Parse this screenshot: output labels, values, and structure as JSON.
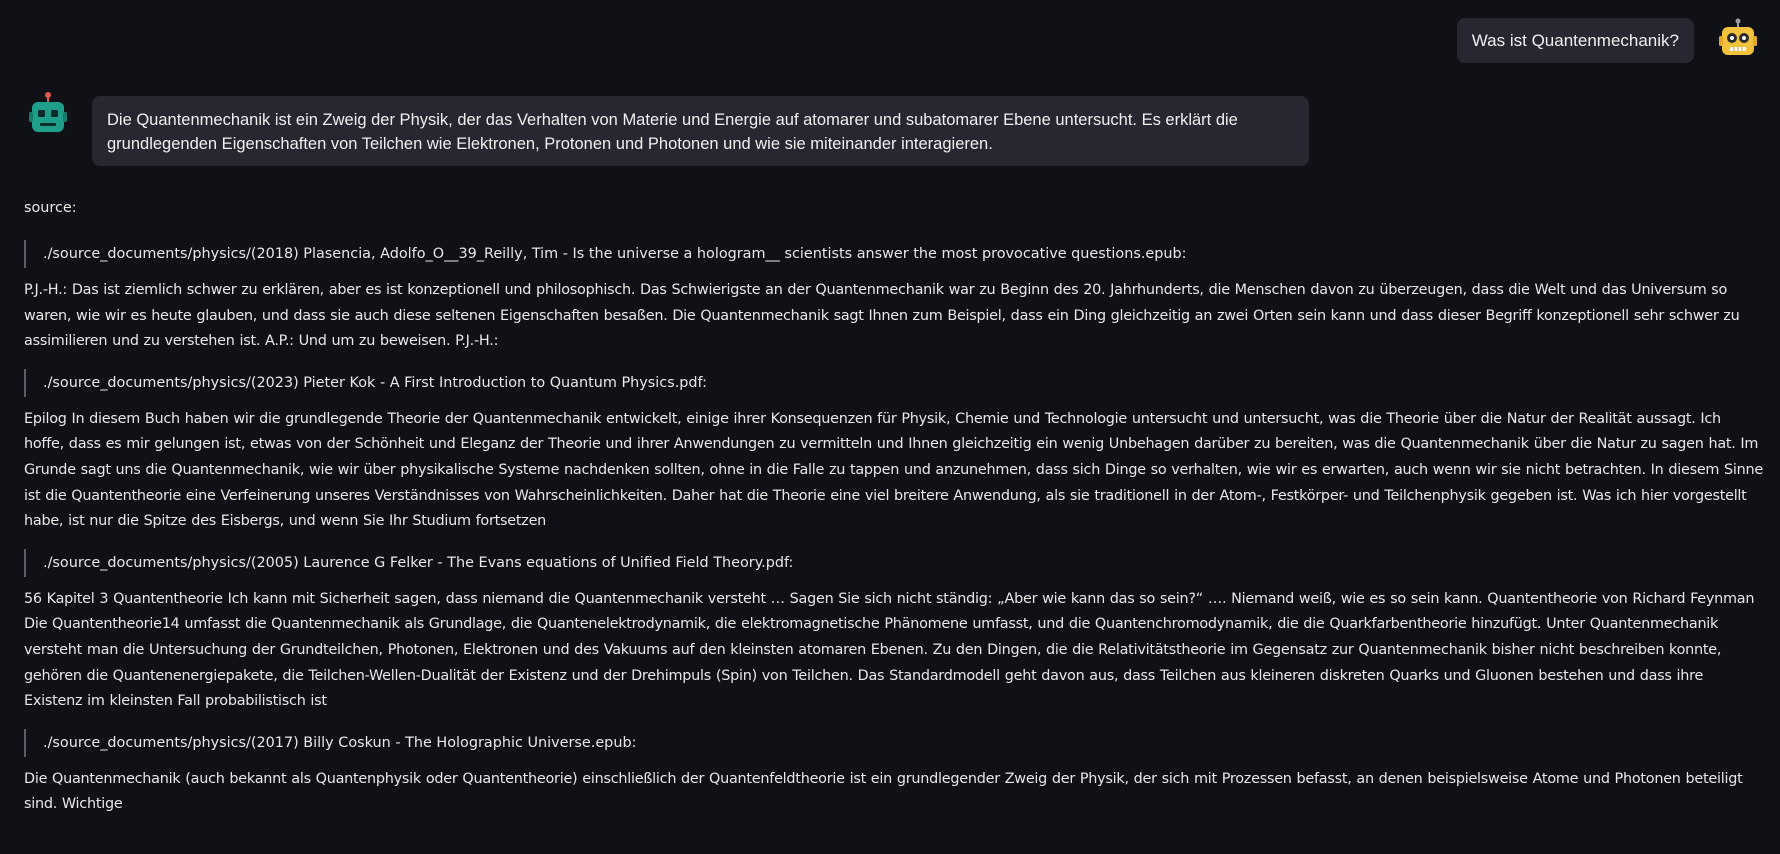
{
  "user_message": {
    "text": "Was ist Quantenmechanik?",
    "avatar_icon": "robot-yellow-icon"
  },
  "assistant_message": {
    "text": "Die Quantenmechanik ist ein Zweig der Physik, der das Verhalten von Materie und Energie auf atomarer und subatomarer Ebene untersucht. Es erklärt die grundlegenden Eigenschaften von Teilchen wie Elektronen, Protonen und Photonen und wie sie miteinander interagieren.",
    "avatar_icon": "robot-teal-icon"
  },
  "sources": {
    "label": "source:",
    "items": [
      {
        "path": "./source_documents/physics/(2018) Plasencia, Adolfo_O__39_Reilly, Tim - Is the universe a hologram__ scientists answer the most provocative questions.epub:",
        "excerpt": "P.J.-H.: Das ist ziemlich schwer zu erklären, aber es ist konzeptionell und philosophisch. Das Schwierigste an der Quantenmechanik war zu Beginn des 20. Jahrhunderts, die Menschen davon zu überzeugen, dass die Welt und das Universum so waren, wie wir es heute glauben, und dass sie auch diese seltenen Eigenschaften besaßen. Die Quantenmechanik sagt Ihnen zum Beispiel, dass ein Ding gleichzeitig an zwei Orten sein kann und dass dieser Begriff konzeptionell sehr schwer zu assimilieren und zu verstehen ist. A.P.: Und um zu beweisen. P.J.-H.:"
      },
      {
        "path": "./source_documents/physics/(2023) Pieter Kok - A First Introduction to Quantum Physics.pdf:",
        "excerpt": "Epilog In diesem Buch haben wir die grundlegende Theorie der Quantenmechanik entwickelt, einige ihrer Konsequenzen für Physik, Chemie und Technologie untersucht und untersucht, was die Theorie über die Natur der Realität aussagt. Ich hoffe, dass es mir gelungen ist, etwas von der Schönheit und Eleganz der Theorie und ihrer Anwendungen zu vermitteln und Ihnen gleichzeitig ein wenig Unbehagen darüber zu bereiten, was die Quantenmechanik über die Natur zu sagen hat. Im Grunde sagt uns die Quantenmechanik, wie wir über physikalische Systeme nachdenken sollten, ohne in die Falle zu tappen und anzunehmen, dass sich Dinge so verhalten, wie wir es erwarten, auch wenn wir sie nicht betrachten. In diesem Sinne ist die Quantentheorie eine Verfeinerung unseres Verständnisses von Wahrscheinlichkeiten. Daher hat die Theorie eine viel breitere Anwendung, als sie traditionell in der Atom-, Festkörper- und Teilchenphysik gegeben ist. Was ich hier vorgestellt habe, ist nur die Spitze des Eisbergs, und wenn Sie Ihr Studium fortsetzen"
      },
      {
        "path": "./source_documents/physics/(2005) Laurence G Felker - The Evans equations of Unified Field Theory.pdf:",
        "excerpt": "56 Kapitel 3 Quantentheorie Ich kann mit Sicherheit sagen, dass niemand die Quantenmechanik versteht … Sagen Sie sich nicht ständig: „Aber wie kann das so sein?“ …. Niemand weiß, wie es so sein kann. Quantentheorie von Richard Feynman Die Quantentheorie14 umfasst die Quantenmechanik als Grundlage, die Quantenelektrodynamik, die elektromagnetische Phänomene umfasst, und die Quantenchromodynamik, die die Quarkfarbentheorie hinzufügt. Unter Quantenmechanik versteht man die Untersuchung der Grundteilchen, Photonen, Elektronen und des Vakuums auf den kleinsten atomaren Ebenen. Zu den Dingen, die die Relativitätstheorie im Gegensatz zur Quantenmechanik bisher nicht beschreiben konnte, gehören die Quantenenergiepakete, die Teilchen-Wellen-Dualität der Existenz und der Drehimpuls (Spin) von Teilchen. Das Standardmodell geht davon aus, dass Teilchen aus kleineren diskreten Quarks und Gluonen bestehen und dass ihre Existenz im kleinsten Fall probabilistisch ist"
      },
      {
        "path": "./source_documents/physics/(2017) Billy Coskun - The Holographic Universe.epub:",
        "excerpt": "Die Quantenmechanik (auch bekannt als Quantenphysik oder Quantentheorie) einschließlich der Quantenfeldtheorie ist ein grundlegender Zweig der Physik, der sich mit Prozessen befasst, an denen beispielsweise Atome und Photonen beteiligt sind. Wichtige"
      }
    ]
  }
}
